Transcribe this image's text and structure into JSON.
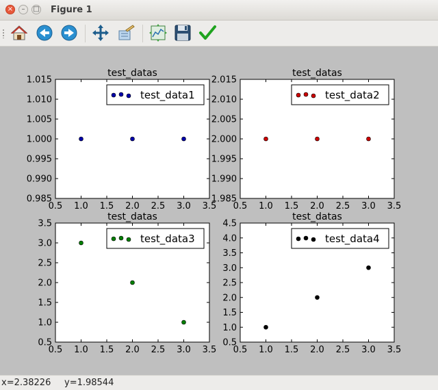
{
  "window": {
    "title": "Figure 1"
  },
  "toolbar": {
    "items": [
      "home-icon",
      "back-arrow-icon",
      "forward-arrow-icon",
      "pan-arrows-icon",
      "zoom-rect-icon",
      "subplots-config-icon",
      "save-floppy-icon",
      "check-icon"
    ]
  },
  "status": {
    "x": "x=2.38226",
    "y": "y=1.98544"
  },
  "colors": {
    "series1": "#0000aa",
    "series2": "#cc0000",
    "series3": "#007f00",
    "series4": "#000000",
    "figure_bg": "#bfbfbf"
  },
  "chart_data": [
    {
      "type": "scatter",
      "title": "test_datas",
      "series": [
        {
          "name": "test_data1",
          "x": [
            1,
            2,
            3
          ],
          "y": [
            1,
            1,
            1
          ]
        }
      ],
      "xlim": [
        0.5,
        3.5
      ],
      "ylim": [
        0.985,
        1.015
      ],
      "xticks": [
        "0.5",
        "1.0",
        "1.5",
        "2.0",
        "2.5",
        "3.0",
        "3.5"
      ],
      "yticks": [
        "0.985",
        "0.990",
        "0.995",
        "1.000",
        "1.005",
        "1.010",
        "1.015"
      ],
      "legend": "top-right"
    },
    {
      "type": "scatter",
      "title": "test_datas",
      "series": [
        {
          "name": "test_data2",
          "x": [
            1,
            2,
            3
          ],
          "y": [
            2,
            2,
            2
          ]
        }
      ],
      "xlim": [
        0.5,
        3.5
      ],
      "ylim": [
        1.985,
        2.015
      ],
      "xticks": [
        "0.5",
        "1.0",
        "1.5",
        "2.0",
        "2.5",
        "3.0",
        "3.5"
      ],
      "yticks": [
        "1.985",
        "1.990",
        "1.995",
        "2.000",
        "2.005",
        "2.010",
        "2.015"
      ],
      "legend": "top-right"
    },
    {
      "type": "scatter",
      "title": "test_datas",
      "series": [
        {
          "name": "test_data3",
          "x": [
            1,
            2,
            3
          ],
          "y": [
            3,
            2,
            1
          ]
        }
      ],
      "xlim": [
        0.5,
        3.5
      ],
      "ylim": [
        0.5,
        3.5
      ],
      "xticks": [
        "0.5",
        "1.0",
        "1.5",
        "2.0",
        "2.5",
        "3.0",
        "3.5"
      ],
      "yticks": [
        "0.5",
        "1.0",
        "1.5",
        "2.0",
        "2.5",
        "3.0",
        "3.5"
      ],
      "legend": "top-right"
    },
    {
      "type": "scatter",
      "title": "test_datas",
      "series": [
        {
          "name": "test_data4",
          "x": [
            1,
            2,
            3
          ],
          "y": [
            1,
            2,
            3
          ]
        }
      ],
      "xlim": [
        0.5,
        3.5
      ],
      "ylim": [
        0.5,
        4.5
      ],
      "xticks": [
        "0.5",
        "1.0",
        "1.5",
        "2.0",
        "2.5",
        "3.0",
        "3.5"
      ],
      "yticks": [
        "0.5",
        "1.0",
        "1.5",
        "2.0",
        "2.5",
        "3.0",
        "3.5",
        "4.0",
        "4.5"
      ],
      "legend": "top-right"
    }
  ]
}
